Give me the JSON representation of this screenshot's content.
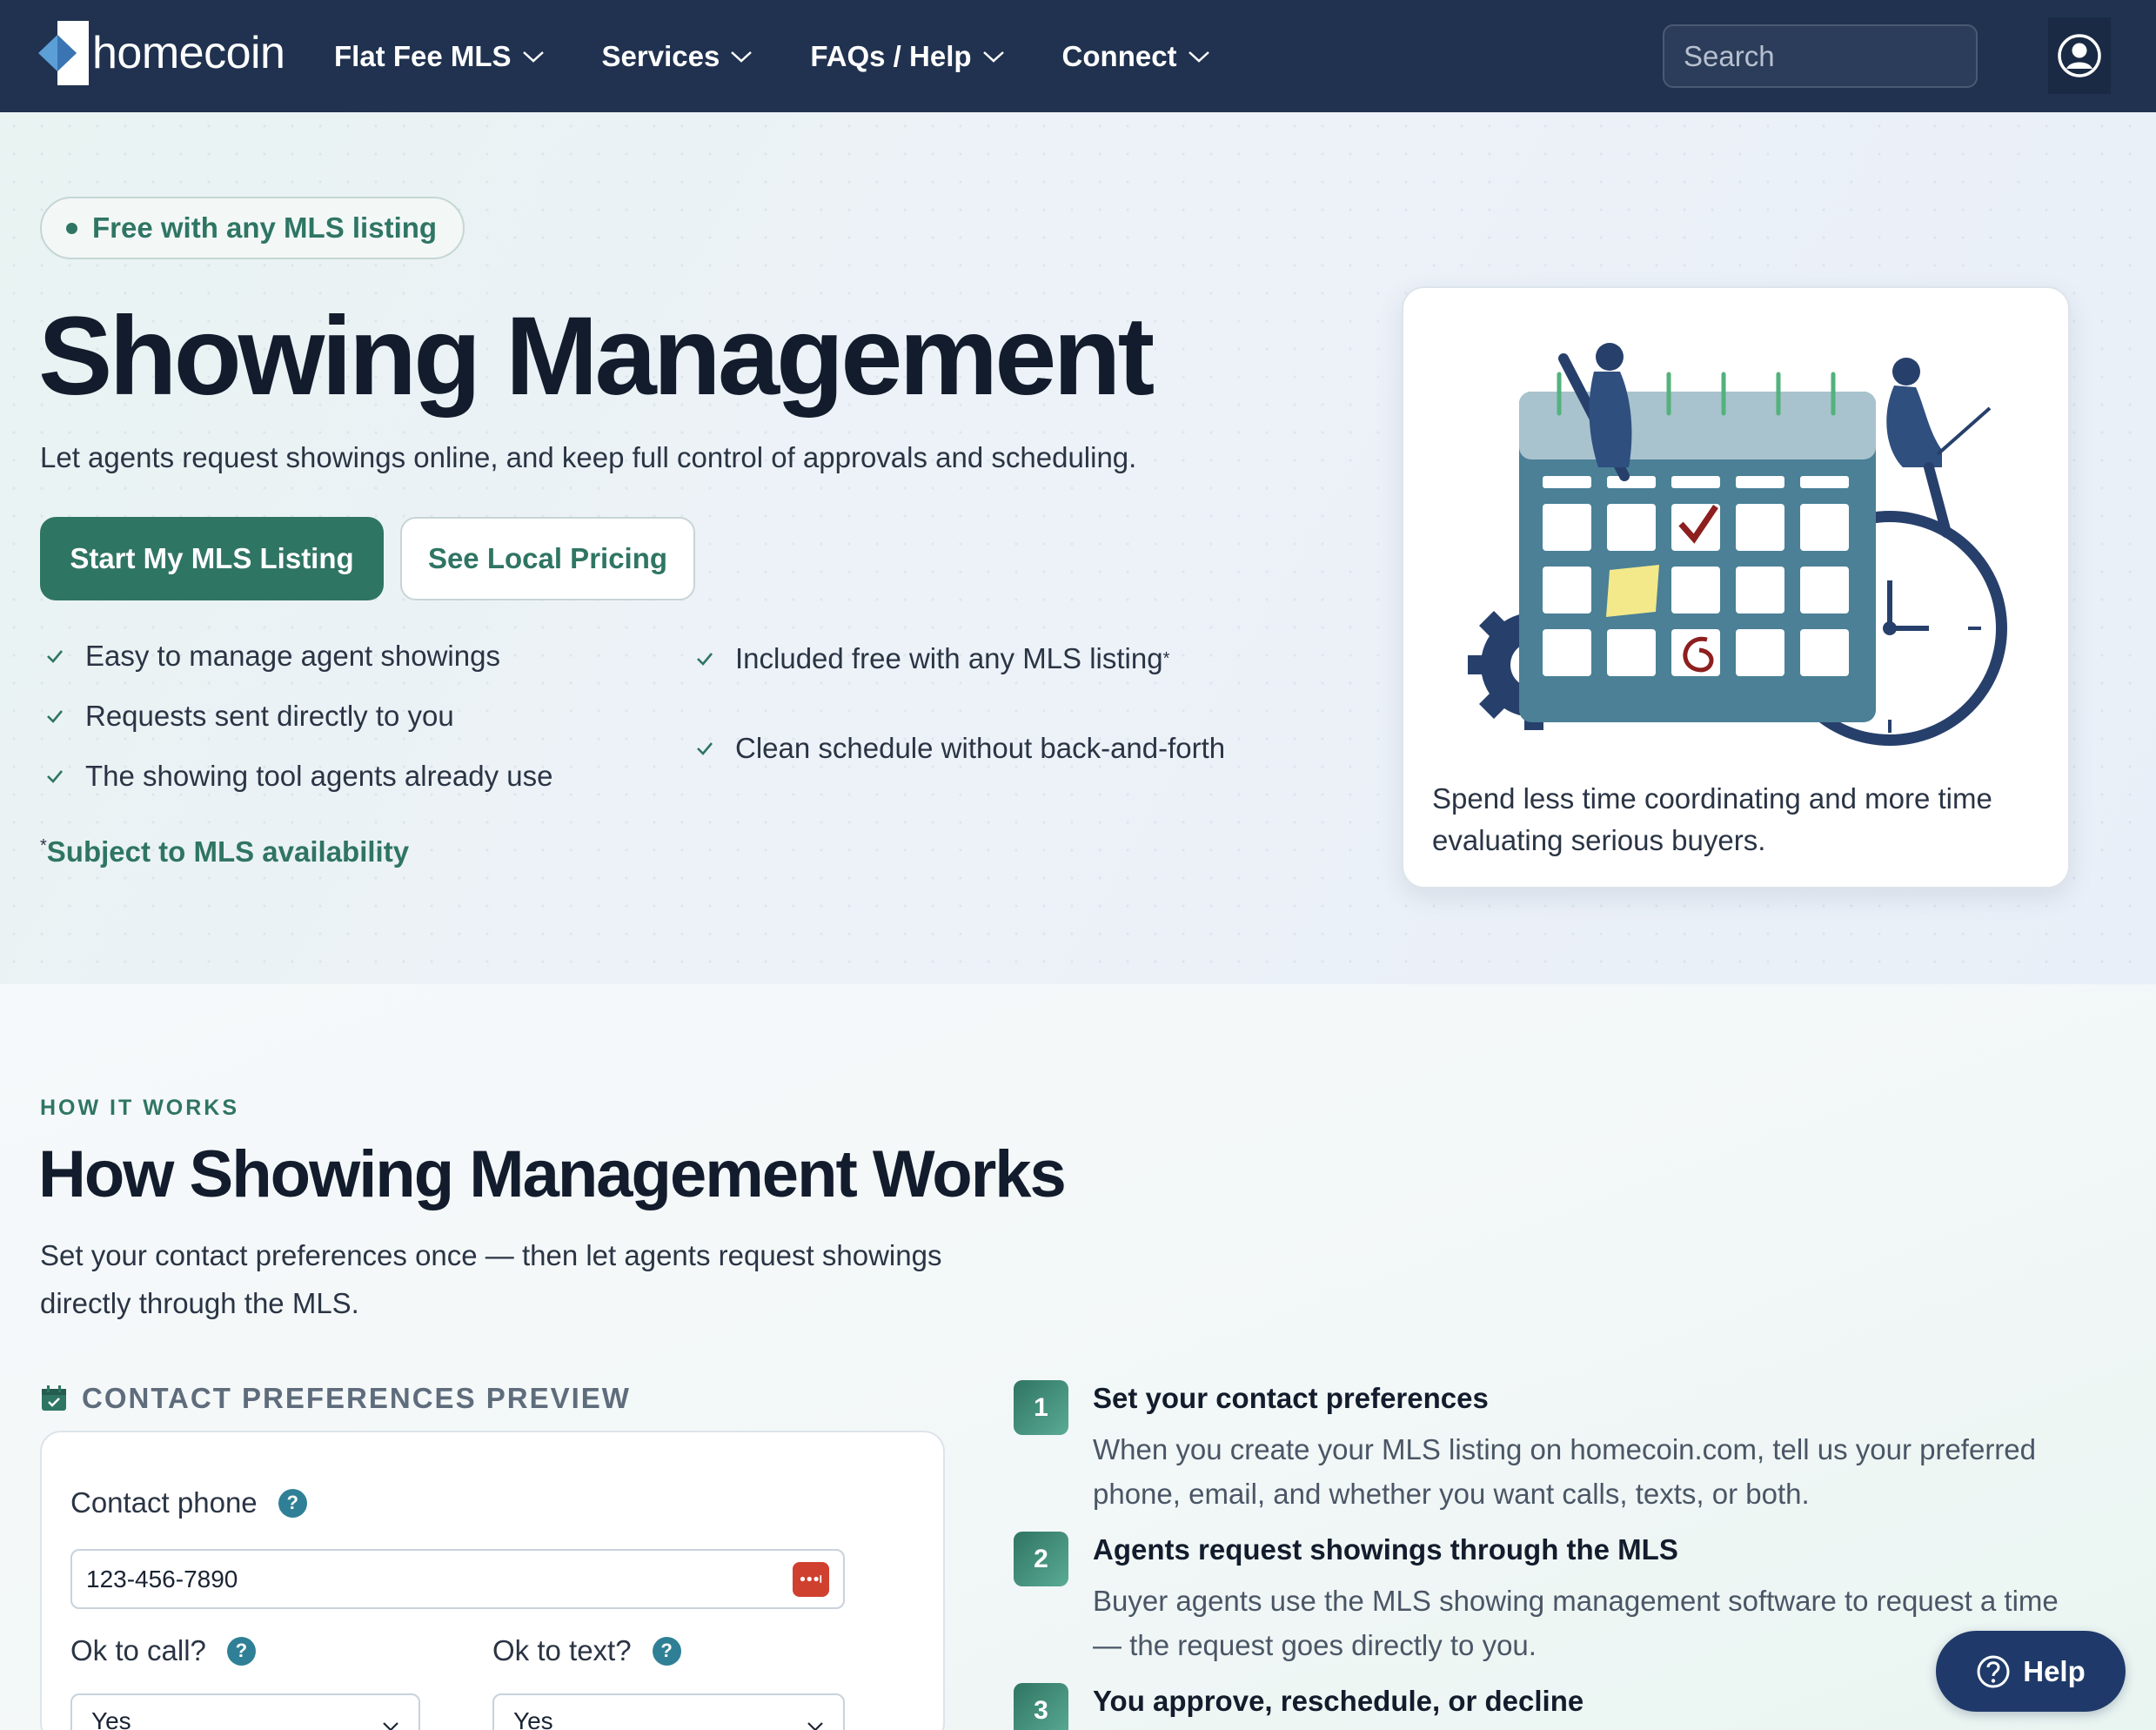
{
  "nav": {
    "brand": "homecoin",
    "items": [
      {
        "label": "Flat Fee MLS"
      },
      {
        "label": "Services"
      },
      {
        "label": "FAQs / Help"
      },
      {
        "label": "Connect"
      }
    ],
    "search_placeholder": "Search"
  },
  "hero": {
    "pill": "Free with any MLS listing",
    "title": "Showing Management",
    "subtitle": "Let agents request showings online, and keep full control of approvals and scheduling.",
    "primary_button": "Start My MLS Listing",
    "secondary_button": "See Local Pricing",
    "features_left": [
      "Easy to manage agent showings",
      "Requests sent directly to you",
      "The showing tool agents already use"
    ],
    "features_right": [
      "Included free with any MLS listing",
      "Clean schedule without back-and-forth"
    ],
    "footnote_mark": "*",
    "footnote": "Subject to MLS availability",
    "card_text": "Spend less time coordinating and more time evaluating serious buyers."
  },
  "how": {
    "eyebrow": "HOW IT WORKS",
    "title": "How Showing Management Works",
    "subtitle": "Set your contact preferences once — then let agents request showings directly through the MLS.",
    "prefs_label": "CONTACT PREFERENCES PREVIEW",
    "contact_phone_label": "Contact phone",
    "contact_phone_value": "123-456-7890",
    "ok_to_call_label": "Ok to call?",
    "ok_to_call_value": "Yes",
    "ok_to_text_label": "Ok to text?",
    "ok_to_text_value": "Yes",
    "help_mark": "?",
    "steps": [
      {
        "num": "1",
        "title": "Set your contact preferences",
        "desc": "When you create your MLS listing on homecoin.com, tell us your preferred phone, email, and whether you want calls, texts, or both."
      },
      {
        "num": "2",
        "title": "Agents request showings through the MLS",
        "desc": "Buyer agents use the MLS showing management software to request a time — the request goes directly to you."
      },
      {
        "num": "3",
        "title": "You approve, reschedule, or decline",
        "desc": ""
      }
    ]
  },
  "help_button": "Help",
  "colors": {
    "nav_bg": "#20324f",
    "brand_green": "#2f7563",
    "help_blue": "#1f3a6a"
  }
}
